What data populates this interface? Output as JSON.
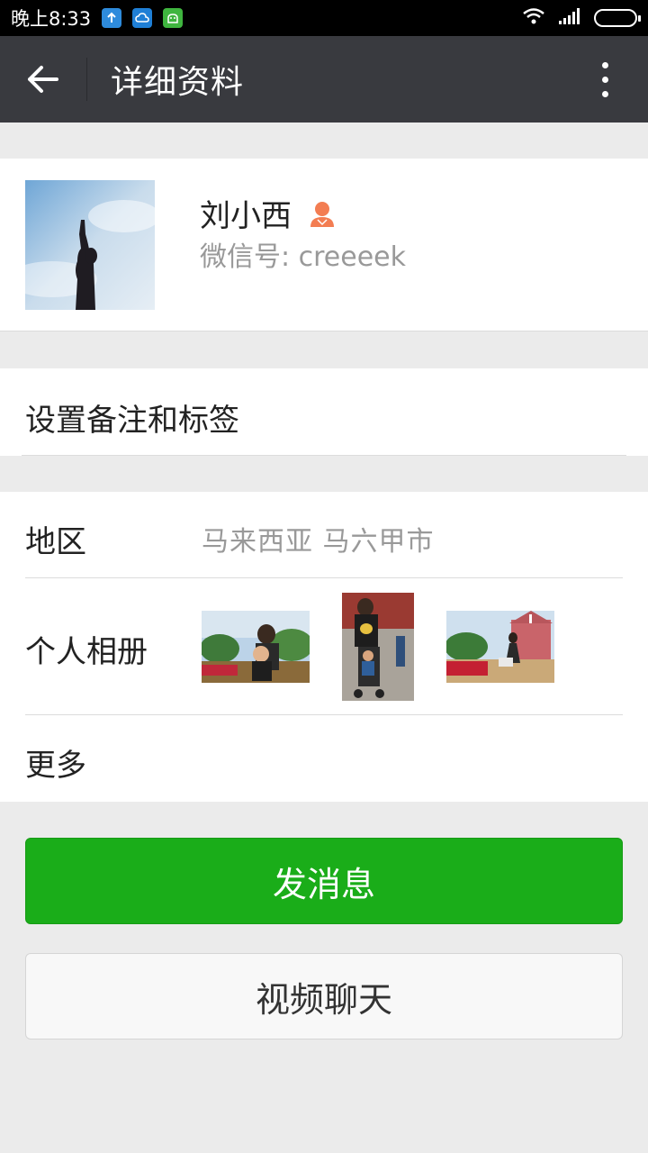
{
  "status_bar": {
    "time": "晚上8:33",
    "app_icons": [
      "upload-icon",
      "cloud-icon",
      "android-icon"
    ],
    "wifi_icon": "wifi-icon",
    "signal_icon": "signal-icon",
    "battery_icon": "battery-icon"
  },
  "app_bar": {
    "title": "详细资料",
    "back_icon": "back-arrow-icon",
    "more_icon": "more-vertical-icon",
    "background": "#393a3f"
  },
  "profile": {
    "name": "刘小西",
    "wechat_id": "微信号: creeeek",
    "gender_icon": "female-icon",
    "gender_color": "#f37d52"
  },
  "remark": {
    "label": "设置备注和标签"
  },
  "info": {
    "region_label": "地区",
    "region_value": "马来西亚  马六甲市",
    "album_label": "个人相册",
    "more_label": "更多"
  },
  "buttons": {
    "send_message": "发消息",
    "video_chat": "视频聊天",
    "send_color": "#1aad19"
  }
}
